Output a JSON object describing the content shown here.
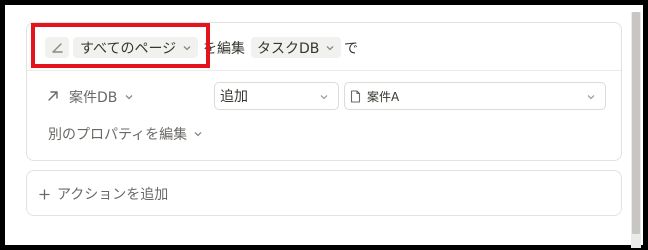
{
  "trigger": {
    "scope_label": "すべてのページ",
    "connector": "を編集",
    "database_label": "タスクDB",
    "suffix": "で"
  },
  "property_row": {
    "property_name": "案件DB",
    "operation_value": "追加",
    "target_value": "案件A"
  },
  "edit_other_label": "別のプロパティを編集",
  "add_action_label": "アクションを追加",
  "colors": {
    "highlight_border": "#e3141b",
    "chip_bg": "#f1f1ef",
    "text": "#37352f",
    "muted_text": "#6b6965"
  }
}
